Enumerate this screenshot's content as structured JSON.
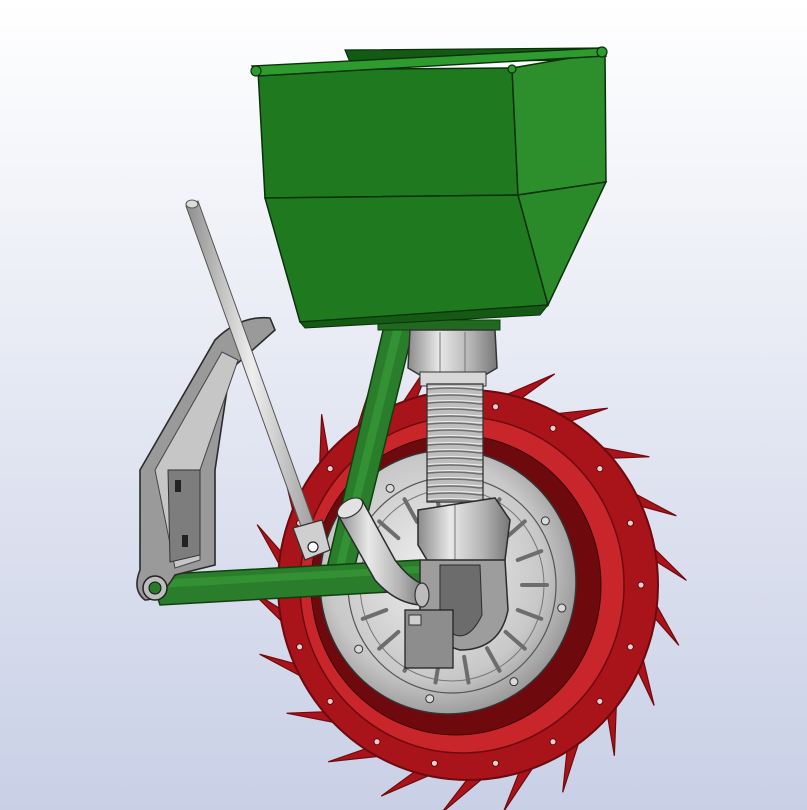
{
  "viewport": {
    "background_top": "#ffffff",
    "background_bottom": "#c9d0e6"
  },
  "colors": {
    "hopper_green": "#1f7a1f",
    "hopper_dark": "#145a14",
    "hopper_light": "#2c9a2c",
    "frame_green": "#2a7d2a",
    "wheel_red": "#a8141a",
    "wheel_dark": "#6e0a0e",
    "wheel_light": "#c9262b",
    "steel": "#b9b9b9",
    "steel_dark": "#7a7a7a",
    "steel_light": "#e6e6e6",
    "bracket_gray": "#8c8c8c",
    "edge": "#1a1a1a"
  },
  "parts": [
    "seed-hopper",
    "seed-tube-bellows",
    "metering-cup",
    "delivery-elbow",
    "control-rod",
    "mounting-bracket",
    "frame-arm",
    "drive-wheel-with-spikes",
    "wheel-hub-disc"
  ]
}
